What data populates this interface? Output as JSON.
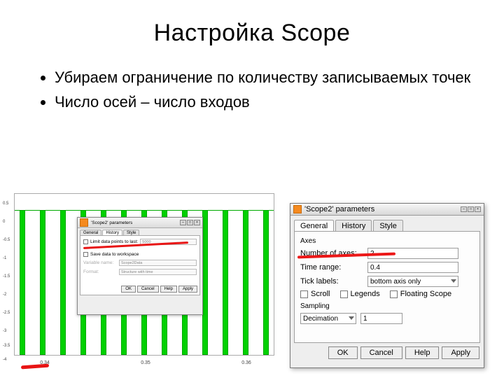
{
  "slide": {
    "title": "Настройка Scope",
    "bullets": [
      "Убираем ограничение по количеству записываемых точек",
      "Число осей – число входов"
    ]
  },
  "chart_data": {
    "type": "bar",
    "title": "",
    "xlabel": "",
    "ylabel": "",
    "ylim": [
      -4,
      0.5
    ],
    "yticks": [
      0.5,
      0,
      -0.5,
      -1,
      -1.5,
      -2,
      -2.5,
      -3,
      -3.5,
      -4
    ],
    "xticks": [
      0.34,
      0.35,
      0.36
    ],
    "values_hint": "vertical green impulses between ~0 and ~-4"
  },
  "left_dialog": {
    "title": "'Scope2' parameters",
    "tabs": [
      "General",
      "History",
      "Style"
    ],
    "active_tab": "History",
    "limit_label": "Limit data points to last:",
    "limit_value": "5000",
    "save_label": "Save data to workspace",
    "var_label": "Variable name:",
    "var_value": "Scope2Data",
    "fmt_label": "Format:",
    "fmt_value": "Structure with time",
    "buttons": [
      "OK",
      "Cancel",
      "Help",
      "Apply"
    ]
  },
  "right_dialog": {
    "title": "'Scope2' parameters",
    "tabs": [
      "General",
      "History",
      "Style"
    ],
    "active_tab": "General",
    "group1": "Axes",
    "num_axes_label": "Number of axes:",
    "num_axes_value": "2",
    "time_range_label": "Time range:",
    "time_range_value": "0.4",
    "tick_label": "Tick labels:",
    "tick_value": "bottom axis only",
    "scroll_label": "Scroll",
    "legends_label": "Legends",
    "floating_label": "Floating Scope",
    "group2": "Sampling",
    "decimation_label": "Decimation",
    "decimation_value": "1",
    "buttons": [
      "OK",
      "Cancel",
      "Help",
      "Apply"
    ]
  }
}
